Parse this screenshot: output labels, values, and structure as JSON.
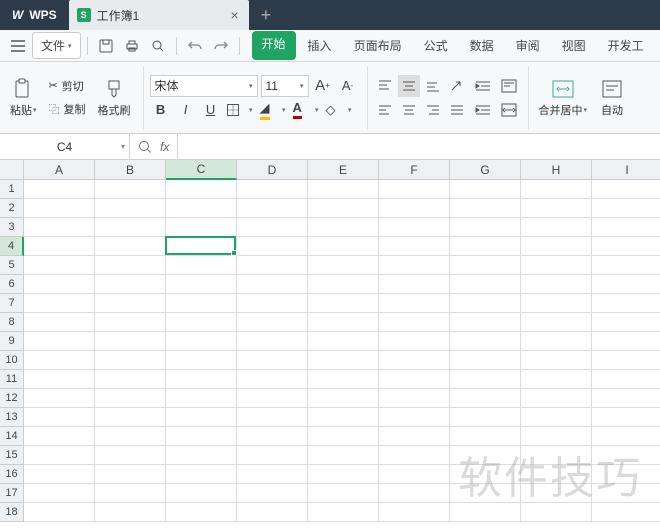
{
  "titlebar": {
    "app_name": "WPS",
    "doc_tab": "工作簿1"
  },
  "menu": {
    "file": "文件",
    "tabs": [
      "开始",
      "插入",
      "页面布局",
      "公式",
      "数据",
      "审阅",
      "视图",
      "开发工"
    ],
    "active_tab_index": 0
  },
  "ribbon": {
    "paste": "粘贴",
    "cut": "剪切",
    "copy": "复制",
    "format_painter": "格式刷",
    "font_name": "宋体",
    "font_size": "11",
    "merge_center": "合并居中",
    "auto_wrap": "自动"
  },
  "formula": {
    "name_box": "C4",
    "fx_value": ""
  },
  "grid": {
    "columns": [
      "A",
      "B",
      "C",
      "D",
      "E",
      "F",
      "G",
      "H",
      "I"
    ],
    "row_count": 18,
    "selected": {
      "col_index": 2,
      "row_index": 3
    }
  },
  "watermark": "软件技巧"
}
